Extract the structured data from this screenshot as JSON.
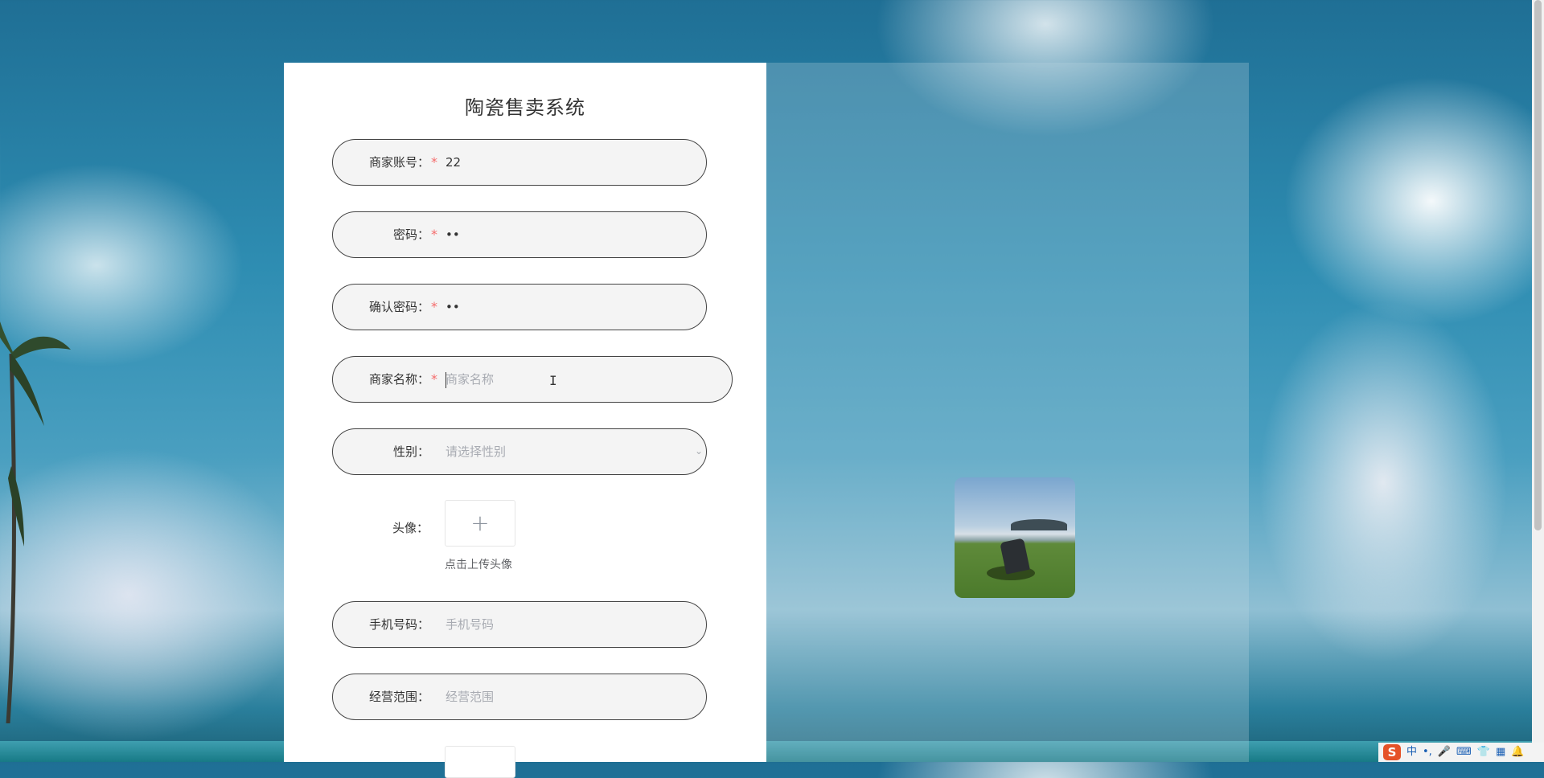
{
  "app": {
    "title": "陶瓷售卖系统"
  },
  "form": {
    "account": {
      "label": "商家账号",
      "required_mark": "*",
      "value": "22"
    },
    "password": {
      "label": "密码",
      "required_mark": "*",
      "value": "••"
    },
    "confirm_password": {
      "label": "确认密码",
      "required_mark": "*",
      "value": "••"
    },
    "merchant_name": {
      "label": "商家名称",
      "required_mark": "*",
      "placeholder": "商家名称"
    },
    "gender": {
      "label": "性别",
      "placeholder": "请选择性别"
    },
    "avatar": {
      "label": "头像",
      "hint": "点击上传头像",
      "plus": "+"
    },
    "phone": {
      "label": "手机号码",
      "placeholder": "手机号码"
    },
    "business_scope": {
      "label": "经营范围",
      "placeholder": "经营范围"
    }
  },
  "label_suffix": "：",
  "icons": {
    "dropdown": "chevron-down-icon",
    "upload": "plus-icon",
    "text_cursor": "ibeam-cursor-icon"
  },
  "taskbar": {
    "ime_logo": "S",
    "ime_mode": "中",
    "items": [
      "•,",
      "🎤",
      "⌨",
      "👕",
      "▦",
      "🔔"
    ]
  },
  "colors": {
    "required": "#f56c6c",
    "placeholder": "#a8abb2",
    "field_border": "#444444"
  }
}
